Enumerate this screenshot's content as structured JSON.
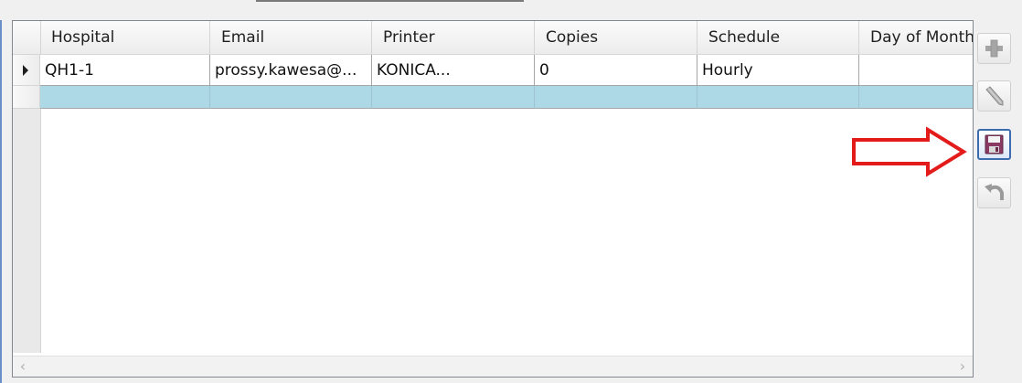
{
  "grid": {
    "columns": [
      "Hospital",
      "Email",
      "Printer",
      "Copies",
      "Schedule",
      "Day of Month"
    ],
    "rows": [
      {
        "hospital": "QH1-1",
        "email": "prossy.kawesa@...",
        "printer": "KONICA...",
        "copies": "0",
        "schedule": "Hourly",
        "day_of_month": ""
      }
    ],
    "new_row_color": "#add8e6"
  },
  "toolbar": {
    "buttons": [
      {
        "name": "add",
        "icon": "plus-icon",
        "state": "disabled"
      },
      {
        "name": "edit",
        "icon": "pencil-icon",
        "state": "disabled"
      },
      {
        "name": "save",
        "icon": "floppy-disk-icon",
        "state": "active"
      },
      {
        "name": "undo",
        "icon": "undo-icon",
        "state": "disabled"
      }
    ]
  },
  "annotation": {
    "type": "arrow",
    "color": "#e31b1b",
    "points_to": "save"
  }
}
